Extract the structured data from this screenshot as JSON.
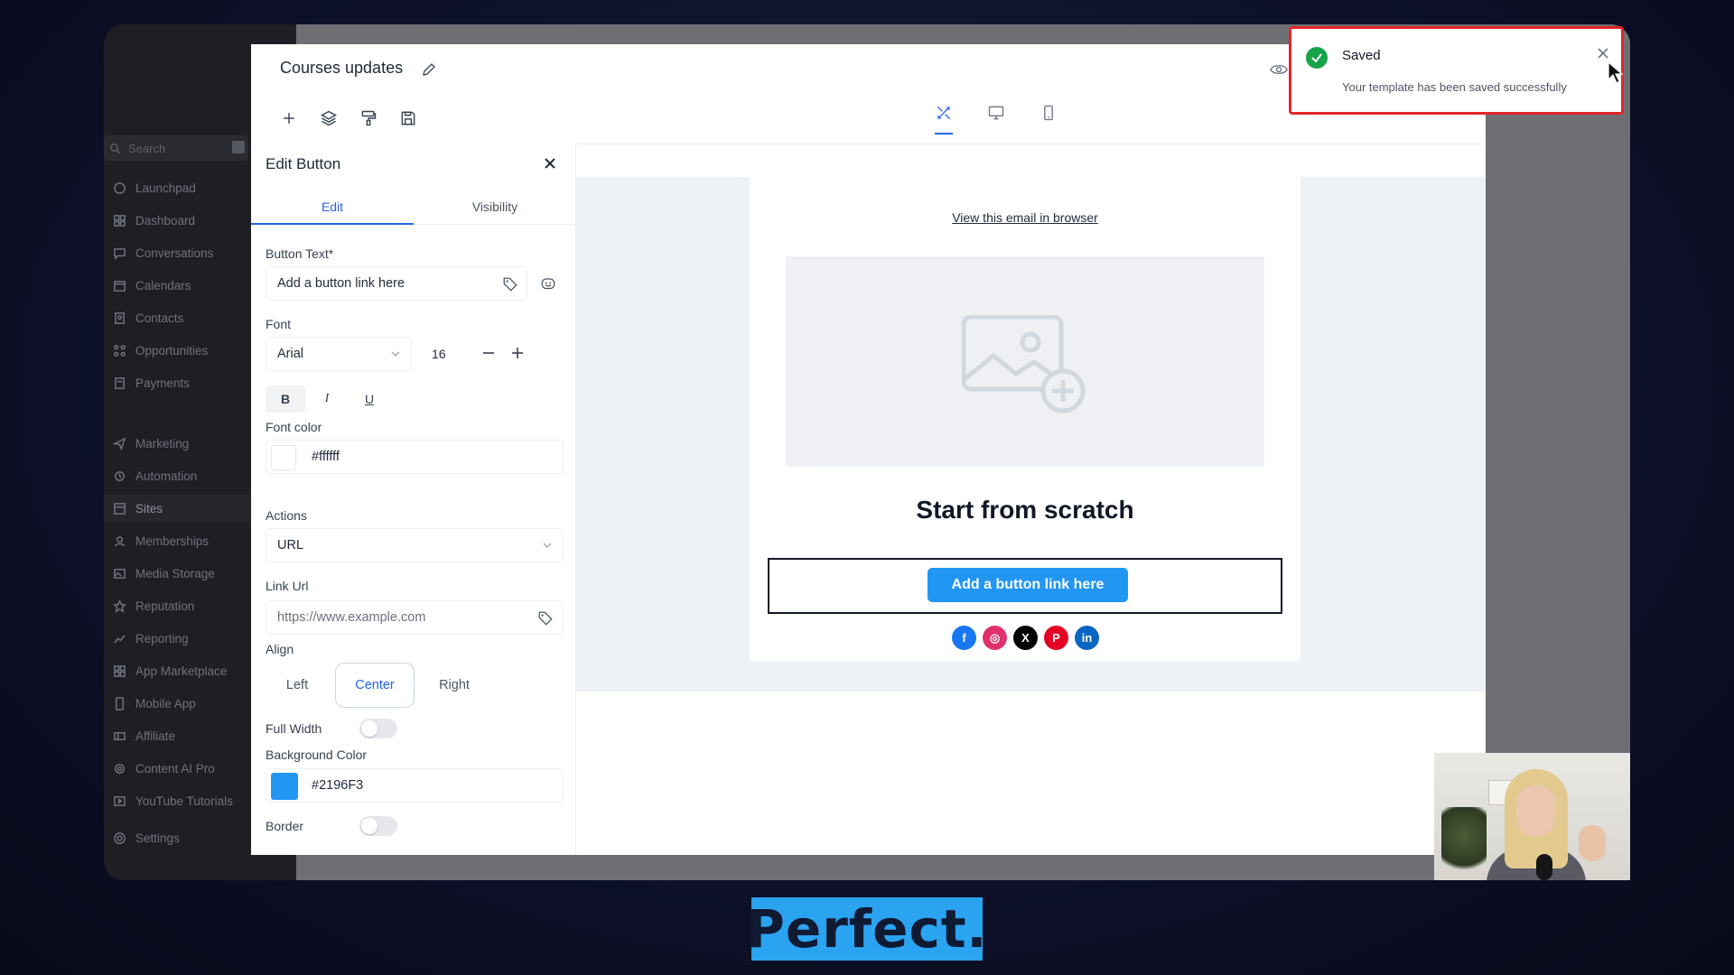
{
  "sidebar": {
    "search_placeholder": "Search",
    "items": [
      {
        "label": "Launchpad",
        "icon": "launchpad-icon"
      },
      {
        "label": "Dashboard",
        "icon": "dashboard-icon"
      },
      {
        "label": "Conversations",
        "icon": "chat-icon"
      },
      {
        "label": "Calendars",
        "icon": "calendar-icon"
      },
      {
        "label": "Contacts",
        "icon": "contacts-icon"
      },
      {
        "label": "Opportunities",
        "icon": "opportunities-icon"
      },
      {
        "label": "Payments",
        "icon": "payments-icon"
      },
      {
        "label": "Marketing",
        "icon": "send-icon"
      },
      {
        "label": "Automation",
        "icon": "automation-icon"
      },
      {
        "label": "Sites",
        "icon": "sites-icon"
      },
      {
        "label": "Memberships",
        "icon": "memberships-icon"
      },
      {
        "label": "Media Storage",
        "icon": "media-icon"
      },
      {
        "label": "Reputation",
        "icon": "star-icon"
      },
      {
        "label": "Reporting",
        "icon": "trend-icon"
      },
      {
        "label": "App Marketplace",
        "icon": "grid-icon"
      },
      {
        "label": "Mobile App",
        "icon": "mobile-icon"
      },
      {
        "label": "Affiliate",
        "icon": "affiliate-icon"
      },
      {
        "label": "Content AI Pro",
        "icon": "ai-icon"
      },
      {
        "label": "YouTube Tutorials",
        "icon": "video-icon"
      },
      {
        "label": "Settings",
        "icon": "gear-icon"
      }
    ],
    "active": "Sites"
  },
  "builder": {
    "title": "Courses updates"
  },
  "edit_panel": {
    "title": "Edit Button",
    "tabs": [
      "Edit",
      "Visibility"
    ],
    "active_tab": "Edit",
    "button_text_label": "Button Text*",
    "button_text_value": "Add a button link here",
    "font_label": "Font",
    "font_value": "Arial",
    "font_size": "16",
    "format_bold": "B",
    "format_italic": "I",
    "format_underline": "U",
    "font_color_label": "Font color",
    "font_color_value": "#ffffff",
    "actions_label": "Actions",
    "actions_value": "URL",
    "link_url_label": "Link Url",
    "link_url_placeholder": "https://www.example.com",
    "align_label": "Align",
    "align_options": [
      "Left",
      "Center",
      "Right"
    ],
    "align_selected": "Center",
    "full_width_label": "Full Width",
    "full_width_on": false,
    "bg_color_label": "Background Color",
    "bg_color_value": "#2196F3",
    "border_label": "Border",
    "border_on": false
  },
  "email": {
    "view_in_browser": "View this email in browser",
    "headline": "Start from scratch",
    "cta_label": "Add a button link here",
    "cta_color": "#2196F3",
    "socials": [
      {
        "name": "facebook",
        "color": "#1877f2",
        "glyph": "f"
      },
      {
        "name": "instagram",
        "color": "#e1306c",
        "glyph": "◎"
      },
      {
        "name": "x",
        "color": "#000000",
        "glyph": "X"
      },
      {
        "name": "pinterest",
        "color": "#e60023",
        "glyph": "P"
      },
      {
        "name": "linkedin",
        "color": "#0a66c2",
        "glyph": "in"
      }
    ]
  },
  "toast": {
    "title": "Saved",
    "message": "Your template has been saved successfully",
    "highlight_color": "#e3262b"
  },
  "caption": {
    "text": "Perfect."
  }
}
